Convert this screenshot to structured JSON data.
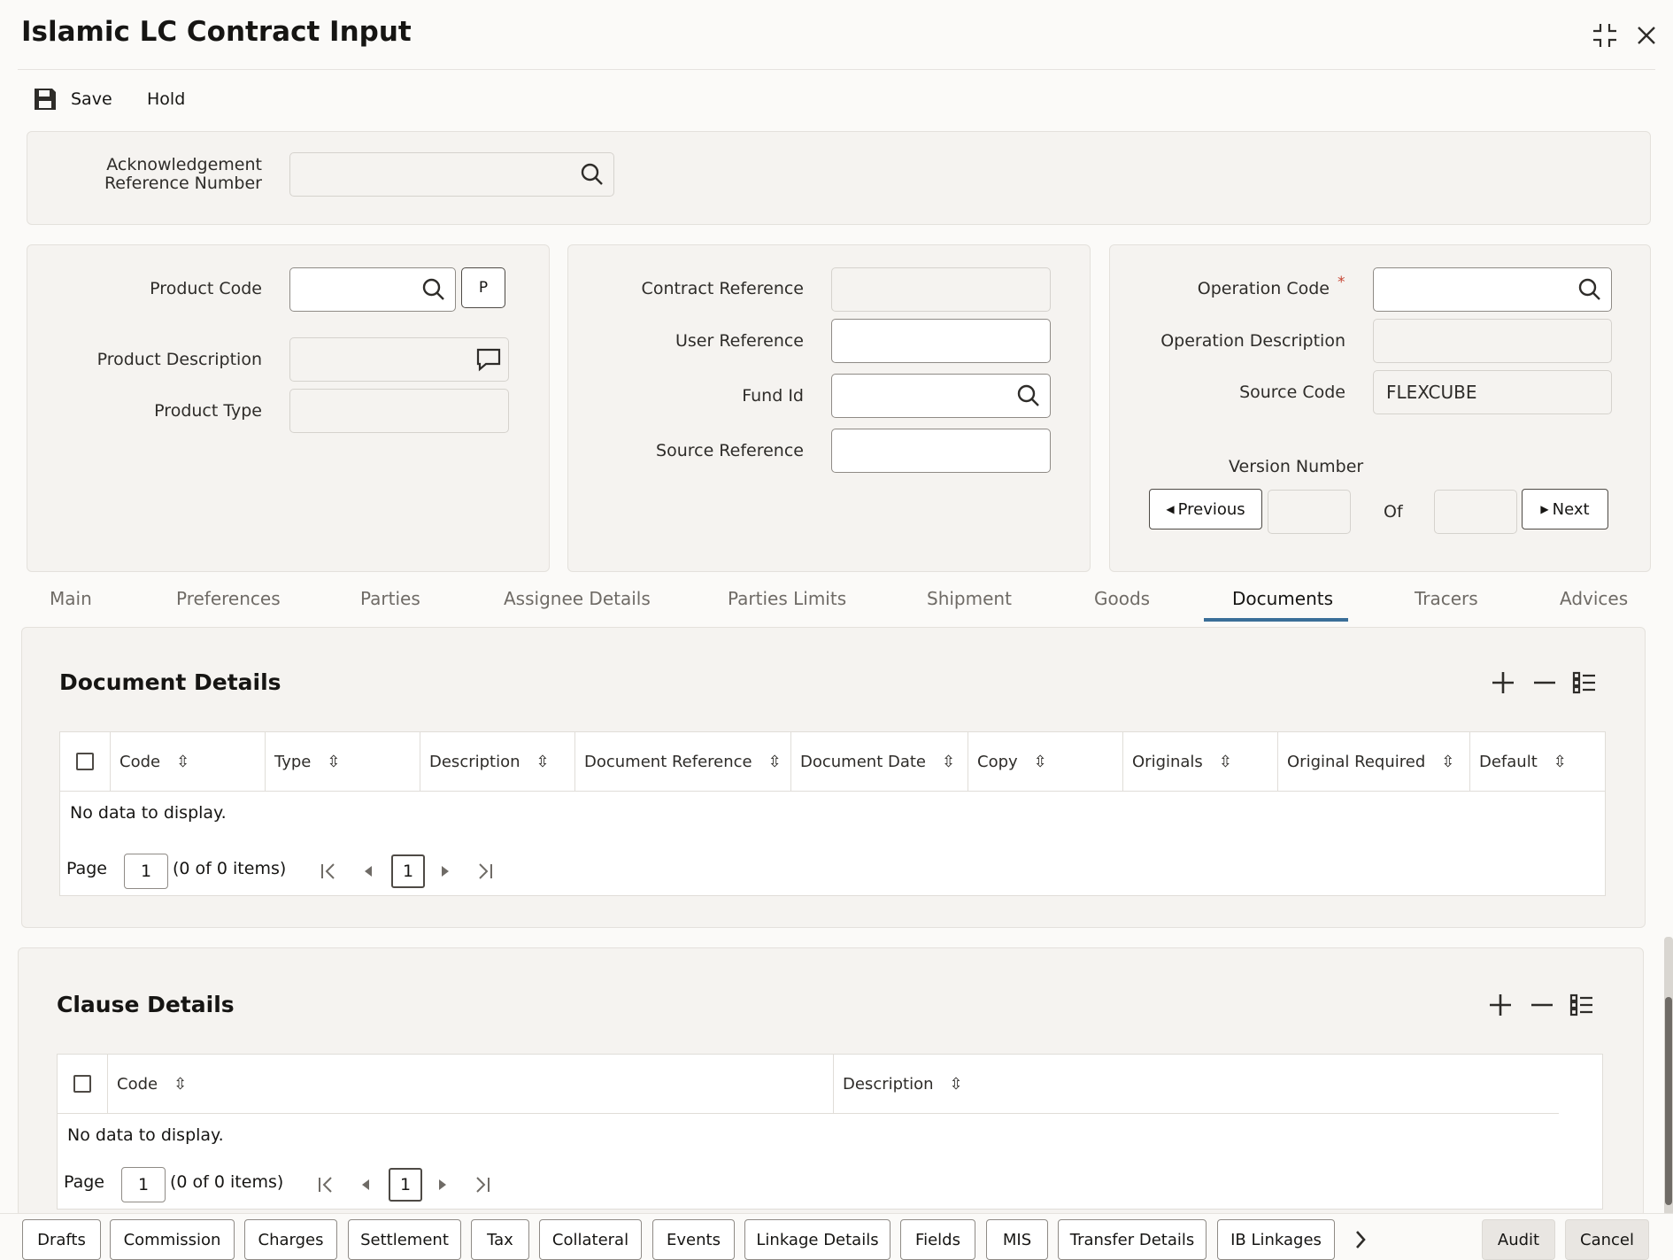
{
  "window": {
    "title": "Islamic LC Contract Input"
  },
  "toolbar": {
    "save_label": "Save",
    "hold_label": "Hold"
  },
  "ack": {
    "label": "Acknowledgement Reference Number"
  },
  "product": {
    "code_label": "Product Code",
    "p_button": "P",
    "description_label": "Product Description",
    "type_label": "Product Type"
  },
  "contract": {
    "ref_label": "Contract Reference",
    "user_ref_label": "User Reference",
    "fund_id_label": "Fund Id",
    "source_ref_label": "Source Reference"
  },
  "operation": {
    "code_label": "Operation Code",
    "required_mark": "*",
    "description_label": "Operation Description",
    "source_code_label": "Source Code",
    "source_code_value": "FLEXCUBE",
    "version_label": "Version Number",
    "previous_label": "Previous",
    "of_label": "Of",
    "next_label": "Next"
  },
  "tabs": [
    {
      "label": "Main"
    },
    {
      "label": "Preferences"
    },
    {
      "label": "Parties"
    },
    {
      "label": "Assignee Details"
    },
    {
      "label": "Parties Limits"
    },
    {
      "label": "Shipment"
    },
    {
      "label": "Goods"
    },
    {
      "label": "Documents"
    },
    {
      "label": "Tracers"
    },
    {
      "label": "Advices"
    }
  ],
  "active_tab": "Documents",
  "documents": {
    "title": "Document Details",
    "columns": [
      "Code",
      "Type",
      "Description",
      "Document Reference",
      "Document Date",
      "Copy",
      "Originals",
      "Original Required",
      "Default"
    ],
    "empty_text": "No data to display.",
    "page_label": "Page",
    "page_value": "1",
    "items_text": "(0 of 0 items)",
    "current_page": "1"
  },
  "clauses": {
    "title": "Clause Details",
    "columns": [
      "Code",
      "Description"
    ],
    "empty_text": "No data to display.",
    "page_label": "Page",
    "page_value": "1",
    "items_text": "(0 of 0 items)",
    "current_page": "1"
  },
  "footer": {
    "buttons": [
      "Drafts",
      "Commission",
      "Charges",
      "Settlement",
      "Tax",
      "Collateral",
      "Events",
      "Linkage Details",
      "Fields",
      "MIS",
      "Transfer Details",
      "IB Linkages"
    ],
    "audit_label": "Audit",
    "cancel_label": "Cancel"
  },
  "colors": {
    "background": "#fbfaf8",
    "panel": "#f5f3f0",
    "active_tab_underline": "#3a6e98",
    "required": "#c74634"
  }
}
